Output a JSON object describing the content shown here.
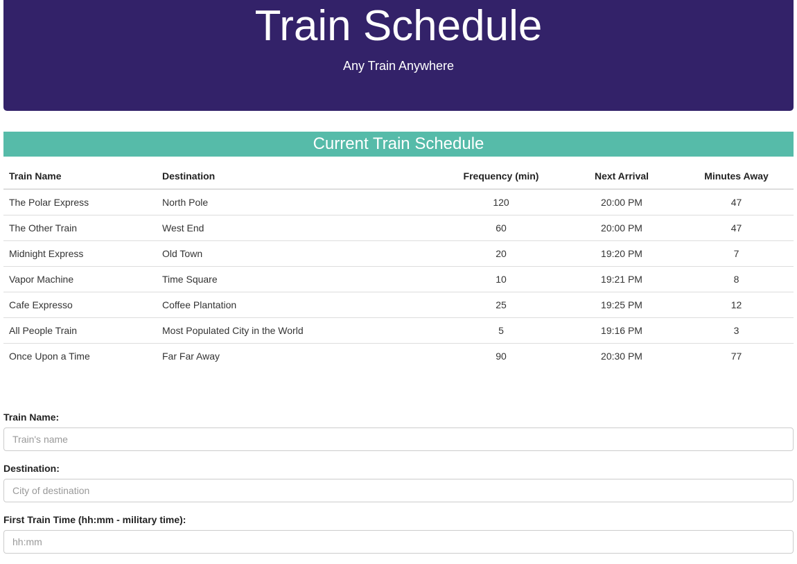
{
  "header": {
    "title": "Train Schedule",
    "subtitle": "Any Train Anywhere"
  },
  "schedule": {
    "heading": "Current Train Schedule",
    "columns": [
      "Train Name",
      "Destination",
      "Frequency (min)",
      "Next Arrival",
      "Minutes Away"
    ],
    "rows": [
      [
        "The Polar Express",
        "North Pole",
        "120",
        "20:00 PM",
        "47"
      ],
      [
        "The Other Train",
        "West End",
        "60",
        "20:00 PM",
        "47"
      ],
      [
        "Midnight Express",
        "Old Town",
        "20",
        "19:20 PM",
        "7"
      ],
      [
        "Vapor Machine",
        "Time Square",
        "10",
        "19:21 PM",
        "8"
      ],
      [
        "Cafe Expresso",
        "Coffee Plantation",
        "25",
        "19:25 PM",
        "12"
      ],
      [
        "All People Train",
        "Most Populated City in the World",
        "5",
        "19:16 PM",
        "3"
      ],
      [
        "Once Upon a Time",
        "Far Far Away",
        "90",
        "20:30 PM",
        "77"
      ]
    ]
  },
  "form": {
    "train_name": {
      "label": "Train Name:",
      "placeholder": "Train's name",
      "value": ""
    },
    "destination": {
      "label": "Destination:",
      "placeholder": "City of destination",
      "value": ""
    },
    "first_time": {
      "label": "First Train Time (hh:mm - military time):",
      "placeholder": "hh:mm",
      "value": ""
    }
  },
  "colors": {
    "header_bg": "#332269",
    "schedule_header_bg": "#56bba9"
  }
}
